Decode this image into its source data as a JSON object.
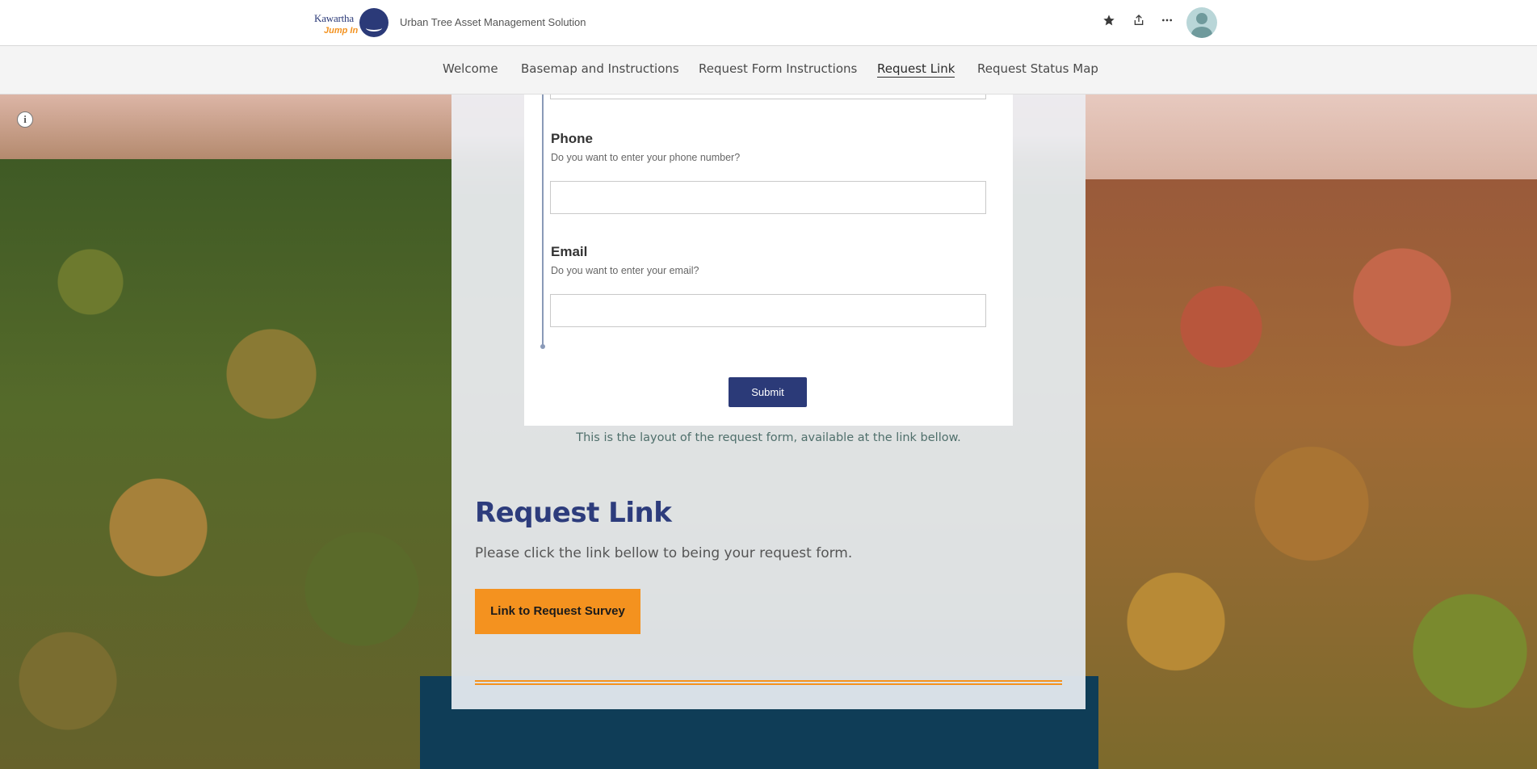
{
  "header": {
    "logo": {
      "name": "Kawartha Lakes",
      "sub": "Jump In"
    },
    "app_title": "Urban Tree Asset Management Solution",
    "icons": [
      "star-icon",
      "share-icon",
      "more-icon",
      "user-avatar-icon"
    ]
  },
  "nav": {
    "items": [
      {
        "label": "Welcome"
      },
      {
        "label": "Basemap and Instructions"
      },
      {
        "label": "Request Form Instructions"
      },
      {
        "label": "Request Link",
        "active": true
      },
      {
        "label": "Request Status Map"
      }
    ]
  },
  "form": {
    "phone": {
      "label": "Phone",
      "help": "Do you want to enter your phone number?",
      "value": ""
    },
    "email": {
      "label": "Email",
      "help": "Do you want to enter your email?",
      "value": ""
    },
    "submit_label": "Submit"
  },
  "caption": "This is the layout of the request form, available at the link bellow.",
  "section": {
    "title": "Request Link",
    "text": "Please click the link bellow to being your request form.",
    "button_label": "Link to Request Survey"
  },
  "colors": {
    "brand": "#2b3a78",
    "accent": "#f4921f"
  }
}
